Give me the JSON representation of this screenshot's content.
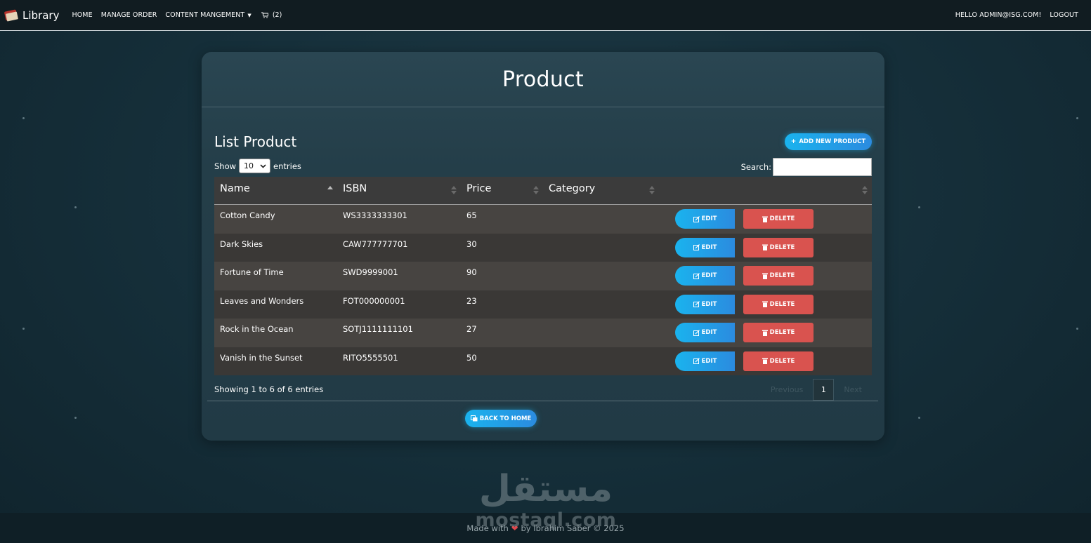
{
  "navbar": {
    "brand": "Library",
    "links": [
      {
        "label": "HOME"
      },
      {
        "label": "MANAGE ORDER"
      },
      {
        "label": "CONTENT MANGEMENT"
      }
    ],
    "cart_count": "(2)",
    "greeting": "HELLO ADMIN@ISG.COM!",
    "logout": "LOGOUT"
  },
  "page": {
    "title": "Product",
    "list_title": "List Product",
    "add_button": "ADD NEW PRODUCT",
    "show_label": "Show",
    "entries_label": "entries",
    "page_size": "10",
    "search_label": "Search:",
    "search_value": ""
  },
  "table": {
    "columns": [
      "Name",
      "ISBN",
      "Price",
      "Category",
      ""
    ],
    "rows": [
      {
        "name": "Cotton Candy",
        "isbn": "WS3333333301",
        "price": "65",
        "category": ""
      },
      {
        "name": "Dark Skies",
        "isbn": "CAW777777701",
        "price": "30",
        "category": ""
      },
      {
        "name": "Fortune of Time",
        "isbn": "SWD9999001",
        "price": "90",
        "category": ""
      },
      {
        "name": "Leaves and Wonders",
        "isbn": "FOT000000001",
        "price": "23",
        "category": ""
      },
      {
        "name": "Rock in the Ocean",
        "isbn": "SOTJ1111111101",
        "price": "27",
        "category": ""
      },
      {
        "name": "Vanish in the Sunset",
        "isbn": "RITO5555501",
        "price": "50",
        "category": ""
      }
    ],
    "edit_label": "EDIT",
    "delete_label": "DELETE"
  },
  "pagination": {
    "info": "Showing 1 to 6 of 6 entries",
    "previous": "Previous",
    "current": "1",
    "next": "Next"
  },
  "back_button": "BACK TO HOME",
  "footer": {
    "made_with": "Made with",
    "by": "by Ibrahim Saber © 2025"
  },
  "watermark": {
    "logo": "مستقل",
    "text": "mostaql.com"
  },
  "colors": {
    "accent": "#1ab3ee",
    "danger": "#d9534f",
    "navbar_bg": "#111c21"
  },
  "icons": [
    "book-logo-icon",
    "cart-icon",
    "plus-icon",
    "edit-icon",
    "trash-icon",
    "home-icon",
    "heart-icon"
  ]
}
